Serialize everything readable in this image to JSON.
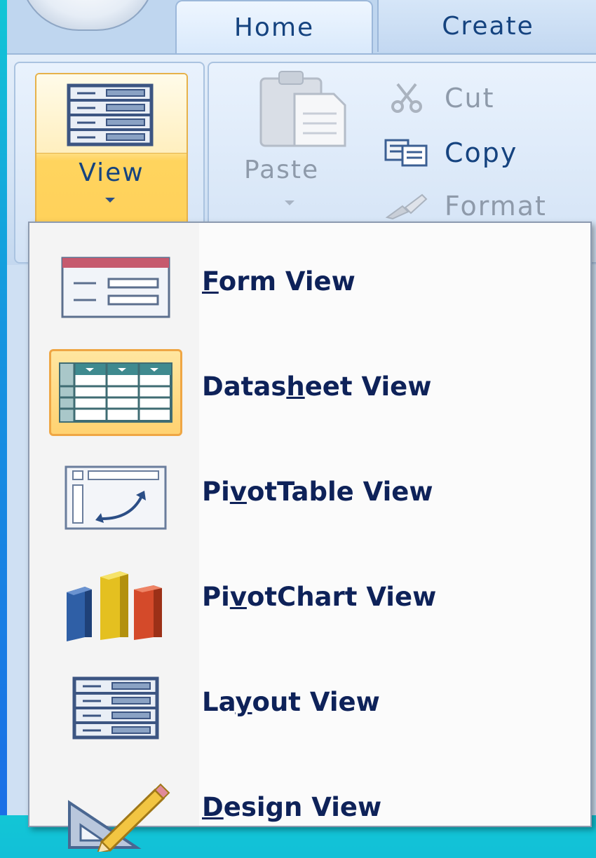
{
  "tabs": [
    {
      "label": "Home",
      "active": true
    },
    {
      "label": "Create",
      "active": false
    }
  ],
  "ribbon": {
    "view_button": {
      "label": "View"
    },
    "paste_button": {
      "label": "Paste"
    },
    "clipboard": [
      {
        "label": "Cut",
        "icon": "scissors-icon",
        "enabled": false
      },
      {
        "label": "Copy",
        "icon": "copy-icon",
        "enabled": true
      },
      {
        "label": "Format",
        "icon": "format-painter-icon",
        "enabled": false
      }
    ]
  },
  "menu": {
    "items": [
      {
        "pre": "",
        "ul": "F",
        "post": "orm View",
        "icon": "form-view-icon",
        "selected": false
      },
      {
        "pre": "Datas",
        "ul": "h",
        "post": "eet View",
        "icon": "datasheet-view-icon",
        "selected": true
      },
      {
        "pre": "Pi",
        "ul": "v",
        "post": "otTable View",
        "icon": "pivottable-view-icon",
        "selected": false
      },
      {
        "pre": "Pi",
        "ul": "v",
        "post": "otChart View",
        "icon": "pivotchart-view-icon",
        "selected": false
      },
      {
        "pre": "La",
        "ul": "y",
        "post": "out View",
        "icon": "layout-view-icon",
        "selected": false
      },
      {
        "pre": "",
        "ul": "D",
        "post": "esign View",
        "icon": "design-view-icon",
        "selected": false
      }
    ]
  },
  "colors": {
    "accent_text": "#15437f",
    "menu_text": "#0e2259",
    "selected_bg": "#ffd271",
    "selected_border": "#efa644",
    "background": "#1596e0"
  }
}
